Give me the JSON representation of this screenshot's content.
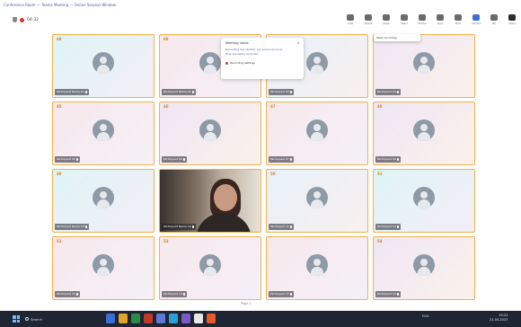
{
  "window": {
    "caption": "Conference Room — Teams Meeting — Online Session Window"
  },
  "meeting": {
    "elapsed": "04:32"
  },
  "toolbar": [
    {
      "label": "Chat",
      "icon": "chat-icon"
    },
    {
      "label": "People",
      "icon": "people-icon"
    },
    {
      "label": "Raise",
      "icon": "hand-icon"
    },
    {
      "label": "React",
      "icon": "react-icon"
    },
    {
      "label": "Rooms",
      "icon": "rooms-icon"
    },
    {
      "label": "Apps",
      "icon": "apps-icon"
    },
    {
      "label": "More",
      "icon": "more-icon"
    },
    {
      "label": "Camera",
      "icon": "camera-icon"
    },
    {
      "label": "Mic",
      "icon": "mic-icon"
    },
    {
      "label": "Share",
      "icon": "share-icon"
    },
    {
      "label": "Leave",
      "icon": "leave-icon"
    }
  ],
  "tiles": [
    {
      "num": "68",
      "name": "Participant Name 01",
      "color": "c0",
      "video": false
    },
    {
      "num": "69",
      "name": "Participant Name 02",
      "color": "c1",
      "video": false
    },
    {
      "num": "",
      "name": "Participant 03",
      "color": "c2",
      "video": false
    },
    {
      "num": "",
      "name": "Participant 04",
      "color": "c3",
      "video": false
    },
    {
      "num": "45",
      "name": "Participant 05",
      "color": "c1",
      "video": false
    },
    {
      "num": "46",
      "name": "Participant 06",
      "color": "c3",
      "video": false
    },
    {
      "num": "47",
      "name": "Participant 07",
      "color": "c1",
      "video": false
    },
    {
      "num": "48",
      "name": "Participant 08",
      "color": "c3",
      "video": false
    },
    {
      "num": "49",
      "name": "Participant Name 09",
      "color": "c0",
      "video": false
    },
    {
      "num": "",
      "name": "Participant Name 10",
      "color": "c1",
      "video": true
    },
    {
      "num": "50",
      "name": "Participant 11",
      "color": "c2",
      "video": false
    },
    {
      "num": "51",
      "name": "Participant 12",
      "color": "c0",
      "video": false
    },
    {
      "num": "52",
      "name": "Participant 13",
      "color": "c1",
      "video": false
    },
    {
      "num": "53",
      "name": "Participant 14",
      "color": "c1",
      "video": false
    },
    {
      "num": "",
      "name": "Participant 15",
      "color": "c1",
      "video": false
    },
    {
      "num": "54",
      "name": "Participant 16",
      "color": "c3",
      "video": false
    }
  ],
  "popup": {
    "title": "Meeting notes",
    "line1": "Recording has started. Let everyone know",
    "line2": "they are being recorded.",
    "button": "Recording settings"
  },
  "tooltip": "Start recording",
  "pager": "Page 1",
  "taskbar": {
    "search": "Search",
    "tray": "ENG",
    "time": "10:24",
    "date": "21-04-2023",
    "apps": [
      "#3b6fd4",
      "#e0a22a",
      "#2a8a4a",
      "#c0392b",
      "#5a7ad6",
      "#2a9fd6",
      "#7a5ac6",
      "#e8e8e8",
      "#e65a2a"
    ]
  }
}
